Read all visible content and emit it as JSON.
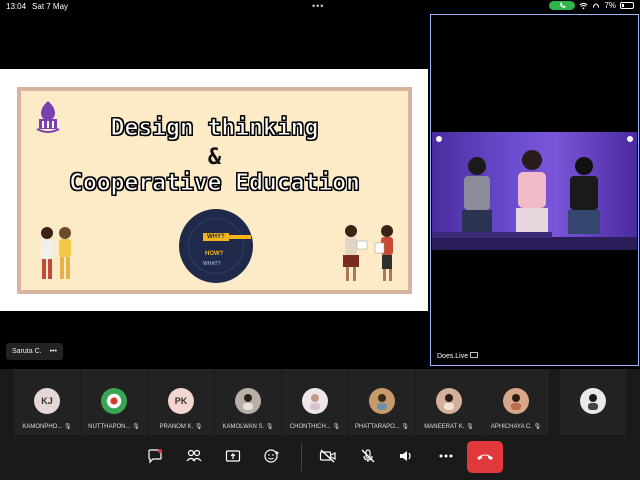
{
  "status_bar": {
    "time": "13:04",
    "date": "Sat 7 May",
    "battery": "7%"
  },
  "slide": {
    "title_line1": "Design thinking",
    "ampersand": "&",
    "title_line2": "Cooperative Education",
    "target_why": "WHY?",
    "target_how": "HOW?",
    "target_what": "WHAT?"
  },
  "presenter_chip": {
    "name": "Saruta C.",
    "menu": "•••"
  },
  "speaker_tile": {
    "label": "Does.Live"
  },
  "participants": [
    {
      "initials": "KJ",
      "name": "KAMONPHO...",
      "avatar_color": "#e6d6d6"
    },
    {
      "initials": "",
      "name": "NUTTHAPON...",
      "avatar_color": "#3aa653"
    },
    {
      "initials": "PK",
      "name": "PRANOM K.",
      "avatar_color": "#f3d7cf"
    },
    {
      "initials": "",
      "name": "KAMOLWAN S.",
      "avatar_color": "#b7b0a8"
    },
    {
      "initials": "",
      "name": "CHONTHICH...",
      "avatar_color": "#efe6ea"
    },
    {
      "initials": "",
      "name": "PHATTARAPO...",
      "avatar_color": "#c69a6a"
    },
    {
      "initials": "",
      "name": "MANEERAT K.",
      "avatar_color": "#d3b09c"
    },
    {
      "initials": "",
      "name": "APHICHAYA C.",
      "avatar_color": "#d9a88a"
    },
    {
      "initials": "",
      "name": "",
      "avatar_color": "#e9e9e9"
    }
  ],
  "colors": {
    "end_call": "#e0383b",
    "active_tile_border": "#9db3ff"
  }
}
